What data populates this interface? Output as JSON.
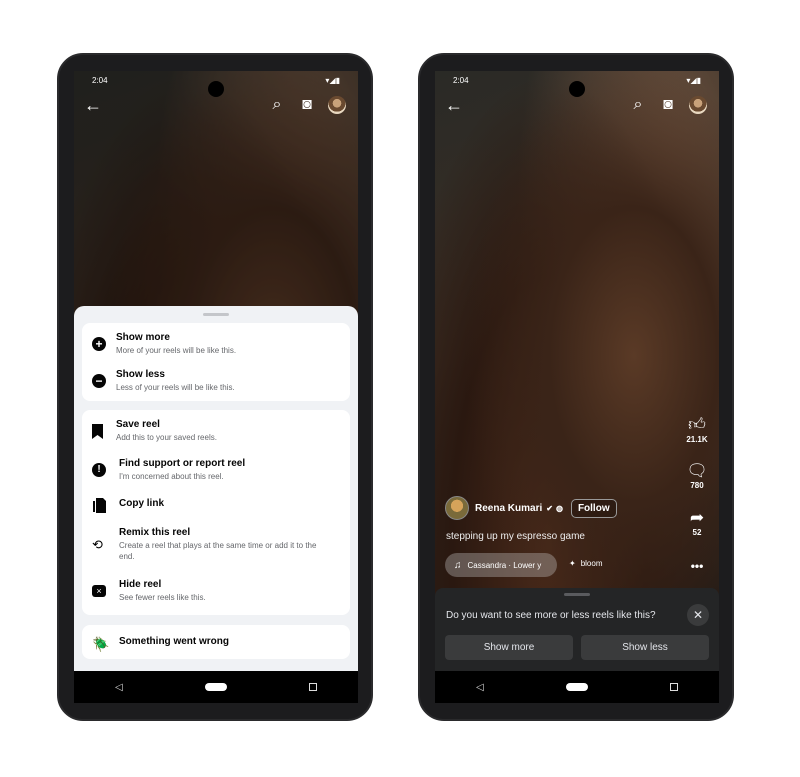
{
  "status": {
    "time": "2:04",
    "icons": [
      "wifi-icon",
      "signal-icon",
      "battery-icon"
    ]
  },
  "left_phone": {
    "menu_groups": [
      [
        {
          "icon": "plus-circle-icon",
          "title": "Show more",
          "subtitle": "More of your reels will be like this."
        },
        {
          "icon": "minus-circle-icon",
          "title": "Show less",
          "subtitle": "Less of your reels will be like this."
        }
      ],
      [
        {
          "icon": "bookmark-icon",
          "title": "Save reel",
          "subtitle": "Add this to your saved reels."
        },
        {
          "icon": "exclamation-circle-icon",
          "title": "Find support or report reel",
          "subtitle": "I'm concerned about this reel."
        },
        {
          "icon": "copy-icon",
          "title": "Copy link"
        },
        {
          "icon": "remix-icon",
          "title": "Remix this reel",
          "subtitle": "Create a reel that plays at the same time or add it to the end."
        },
        {
          "icon": "close-square-icon",
          "title": "Hide reel",
          "subtitle": "See fewer reels like this."
        }
      ],
      [
        {
          "icon": "bug-icon",
          "title": "Something went wrong"
        }
      ]
    ]
  },
  "right_phone": {
    "likes": "21.1K",
    "comments": "780",
    "shares": "52",
    "owner": "Reena Kumari",
    "follow": "Follow",
    "caption": "stepping up my espresso game",
    "music": "Cassandra · Lower y",
    "effect": "bloom",
    "prompt": {
      "question": "Do you want to see more or less reels like this?",
      "more": "Show more",
      "less": "Show less"
    }
  }
}
